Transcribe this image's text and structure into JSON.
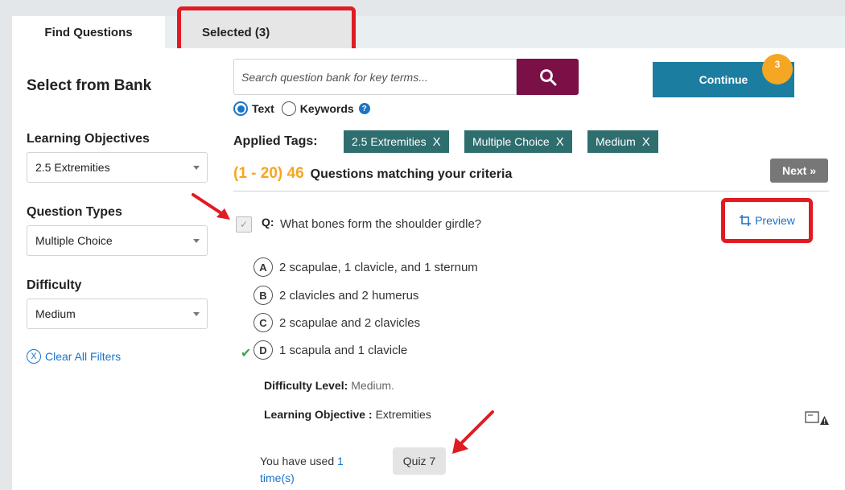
{
  "tabs": {
    "find": "Find Questions",
    "selected": "Selected (3)"
  },
  "sidebar": {
    "title": "Select from Bank",
    "learning_objectives": {
      "label": "Learning Objectives",
      "value": "2.5 Extremities"
    },
    "question_types": {
      "label": "Question Types",
      "value": "Multiple Choice"
    },
    "difficulty": {
      "label": "Difficulty",
      "value": "Medium"
    },
    "clear_filters": "Clear All Filters"
  },
  "search": {
    "placeholder": "Search question bank for key terms...",
    "mode_text": "Text",
    "mode_keywords": "Keywords",
    "mode_selected": "Text"
  },
  "continue": {
    "label": "Continue",
    "badge": "3"
  },
  "applied_tags": {
    "label": "Applied Tags:",
    "tags": [
      "2.5 Extremities",
      "Multiple Choice",
      "Medium"
    ],
    "remove_glyph": "X"
  },
  "results": {
    "range": "(1 - 20) 46",
    "text": "Questions matching your criteria",
    "next": "Next »"
  },
  "question": {
    "prefix": "Q:",
    "text": "What bones form the shoulder girdle?",
    "preview": "Preview",
    "answers": [
      {
        "letter": "A",
        "text": "2 scapulae, 1 clavicle, and 1 sternum"
      },
      {
        "letter": "B",
        "text": "2 clavicles and 2 humerus"
      },
      {
        "letter": "C",
        "text": "2 scapulae and 2 clavicles"
      },
      {
        "letter": "D",
        "text": "1 scapula and 1 clavicle"
      }
    ],
    "correct_letter": "D",
    "difficulty_label": "Difficulty Level:",
    "difficulty_value": "Medium.",
    "objective_label": "Learning Objective :",
    "objective_value": "Extremities",
    "used_prefix": "You have used",
    "used_count": "1",
    "used_suffix": "time(s)",
    "quiz": "Quiz 7"
  },
  "colors": {
    "highlight_red": "#e11b22",
    "search_button": "#7a1046",
    "continue_button": "#1b7ea1",
    "badge": "#f5a623",
    "tag": "#2f6e6e",
    "link": "#1a73c9",
    "correct": "#3aa64c"
  }
}
